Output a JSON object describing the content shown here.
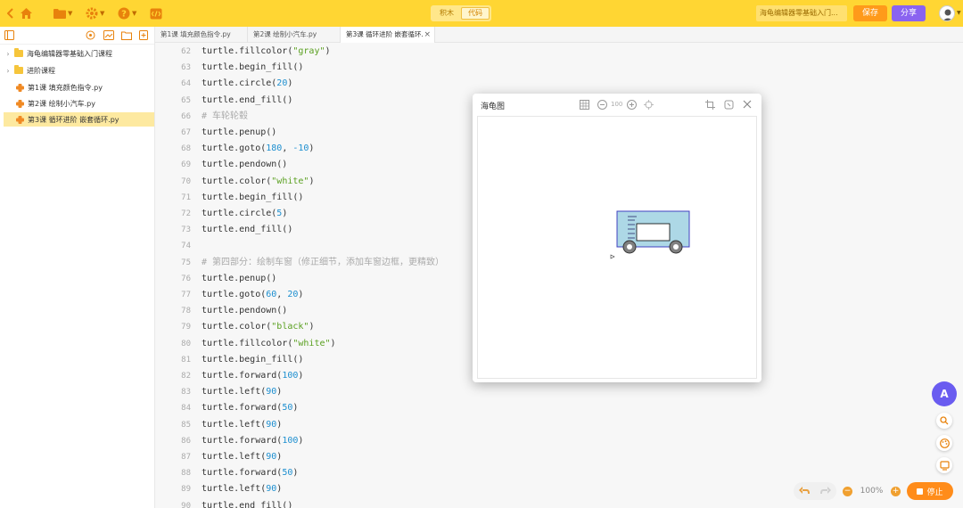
{
  "topbar": {
    "mode_options": [
      "积木",
      "代码"
    ],
    "active_mode": "代码",
    "course_title": "海龟编辑器零基础入门...",
    "save_label": "保存",
    "share_label": "分享"
  },
  "sidebar": {
    "tree": [
      {
        "label": "海龟编辑器零基础入门课程",
        "type": "folder"
      },
      {
        "label": "进阶课程",
        "type": "folder"
      },
      {
        "label": "第1课 填充颜色指令.py",
        "type": "file"
      },
      {
        "label": "第2课 绘制小汽车.py",
        "type": "file"
      },
      {
        "label": "第3课 循环进阶 嵌套循环.py",
        "type": "file",
        "selected": true
      }
    ]
  },
  "tabs": [
    {
      "label": "第1课 填充颜色指令.py"
    },
    {
      "label": "第2课 绘制小汽车.py"
    },
    {
      "label": "第3课 循环进阶 嵌套循环.",
      "active": true,
      "close": "×"
    }
  ],
  "code": [
    {
      "n": "62",
      "parts": [
        [
          "t",
          "turtle.fillcolor("
        ],
        [
          "s",
          "\"gray\""
        ],
        [
          "t",
          ")"
        ]
      ]
    },
    {
      "n": "63",
      "parts": [
        [
          "t",
          "turtle.begin_fill()"
        ]
      ]
    },
    {
      "n": "64",
      "parts": [
        [
          "t",
          "turtle.circle("
        ],
        [
          "n",
          "20"
        ],
        [
          "t",
          ")"
        ]
      ]
    },
    {
      "n": "65",
      "parts": [
        [
          "t",
          "turtle.end_fill()"
        ]
      ]
    },
    {
      "n": "66",
      "parts": [
        [
          "c",
          "# 车轮轮毂"
        ]
      ]
    },
    {
      "n": "67",
      "parts": [
        [
          "t",
          "turtle.penup()"
        ]
      ]
    },
    {
      "n": "68",
      "parts": [
        [
          "t",
          "turtle.goto("
        ],
        [
          "n",
          "180"
        ],
        [
          "t",
          ", "
        ],
        [
          "n",
          "-10"
        ],
        [
          "t",
          ")"
        ]
      ]
    },
    {
      "n": "69",
      "parts": [
        [
          "t",
          "turtle.pendown()"
        ]
      ]
    },
    {
      "n": "70",
      "parts": [
        [
          "t",
          "turtle.color("
        ],
        [
          "s",
          "\"white\""
        ],
        [
          "t",
          ")"
        ]
      ]
    },
    {
      "n": "71",
      "parts": [
        [
          "t",
          "turtle.begin_fill()"
        ]
      ]
    },
    {
      "n": "72",
      "parts": [
        [
          "t",
          "turtle.circle("
        ],
        [
          "n",
          "5"
        ],
        [
          "t",
          ")"
        ]
      ]
    },
    {
      "n": "73",
      "parts": [
        [
          "t",
          "turtle.end_fill()"
        ]
      ]
    },
    {
      "n": "74",
      "parts": []
    },
    {
      "n": "75",
      "parts": [
        [
          "c",
          "# 第四部分：绘制车窗（修正细节，添加车窗边框，更精致）"
        ]
      ]
    },
    {
      "n": "76",
      "parts": [
        [
          "t",
          "turtle.penup()"
        ]
      ]
    },
    {
      "n": "77",
      "parts": [
        [
          "t",
          "turtle.goto("
        ],
        [
          "n",
          "60"
        ],
        [
          "t",
          ", "
        ],
        [
          "n",
          "20"
        ],
        [
          "t",
          ")"
        ]
      ]
    },
    {
      "n": "78",
      "parts": [
        [
          "t",
          "turtle.pendown()"
        ]
      ]
    },
    {
      "n": "79",
      "parts": [
        [
          "t",
          "turtle.color("
        ],
        [
          "s",
          "\"black\""
        ],
        [
          "t",
          ")"
        ]
      ]
    },
    {
      "n": "80",
      "parts": [
        [
          "t",
          "turtle.fillcolor("
        ],
        [
          "s",
          "\"white\""
        ],
        [
          "t",
          ")"
        ]
      ]
    },
    {
      "n": "81",
      "parts": [
        [
          "t",
          "turtle.begin_fill()"
        ]
      ]
    },
    {
      "n": "82",
      "parts": [
        [
          "t",
          "turtle.forward("
        ],
        [
          "n",
          "100"
        ],
        [
          "t",
          ")"
        ]
      ]
    },
    {
      "n": "83",
      "parts": [
        [
          "t",
          "turtle.left("
        ],
        [
          "n",
          "90"
        ],
        [
          "t",
          ")"
        ]
      ]
    },
    {
      "n": "84",
      "parts": [
        [
          "t",
          "turtle.forward("
        ],
        [
          "n",
          "50"
        ],
        [
          "t",
          ")"
        ]
      ]
    },
    {
      "n": "85",
      "parts": [
        [
          "t",
          "turtle.left("
        ],
        [
          "n",
          "90"
        ],
        [
          "t",
          ")"
        ]
      ]
    },
    {
      "n": "86",
      "parts": [
        [
          "t",
          "turtle.forward("
        ],
        [
          "n",
          "100"
        ],
        [
          "t",
          ")"
        ]
      ]
    },
    {
      "n": "87",
      "parts": [
        [
          "t",
          "turtle.left("
        ],
        [
          "n",
          "90"
        ],
        [
          "t",
          ")"
        ]
      ]
    },
    {
      "n": "88",
      "parts": [
        [
          "t",
          "turtle.forward("
        ],
        [
          "n",
          "50"
        ],
        [
          "t",
          ")"
        ]
      ]
    },
    {
      "n": "89",
      "parts": [
        [
          "t",
          "turtle.left("
        ],
        [
          "n",
          "90"
        ],
        [
          "t",
          ")"
        ]
      ]
    },
    {
      "n": "90",
      "parts": [
        [
          "t",
          "turtle.end_fill()"
        ]
      ]
    }
  ],
  "turtle_window": {
    "title": "海龟图",
    "zoom": "100"
  },
  "bottom": {
    "zoom": "100%",
    "stop_label": "停止"
  },
  "float": {
    "ai_label": "A"
  },
  "colors": {
    "topbar": "#ffd633",
    "accent_orange": "#ff8c1a",
    "share_purple": "#8a63f0",
    "car_body": "#add8e6"
  }
}
